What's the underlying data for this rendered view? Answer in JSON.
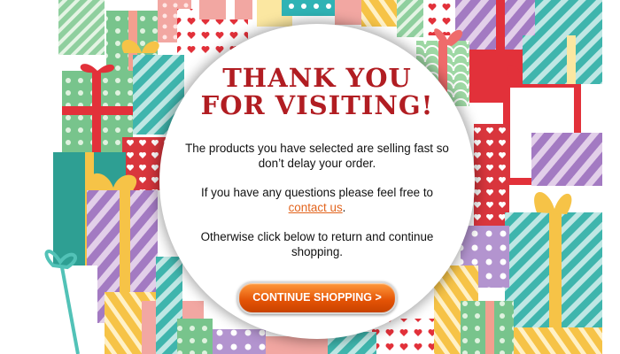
{
  "modal": {
    "title_line1": "THANK YOU",
    "title_line2": "FOR VISITING!",
    "message_1": "The products you have selected are selling fast so don’t delay your order.",
    "message_2_prefix": "If you have any questions please feel free to",
    "contact_link": "contact us",
    "message_2_suffix": ".",
    "message_3": "Otherwise click below to return and continue shopping.",
    "button_label": "CONTINUE SHOPPING >"
  },
  "colors": {
    "title": "#b11d22",
    "link": "#e2641d",
    "button": "#e35205"
  }
}
